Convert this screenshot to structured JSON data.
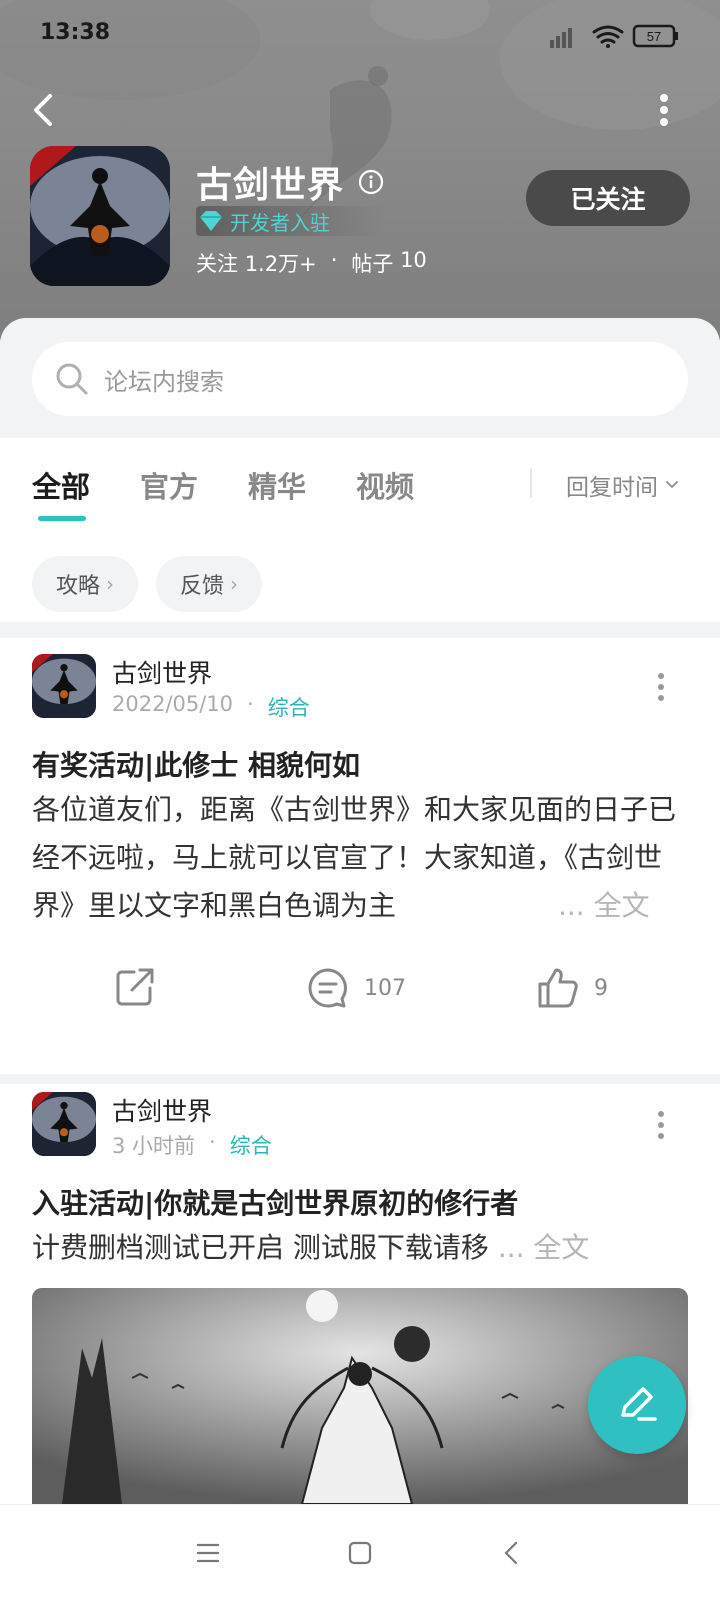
{
  "status_bar": {
    "time": "13:38",
    "battery": "57",
    "icons": [
      "signal-icon",
      "wifi-icon",
      "battery-icon"
    ]
  },
  "header": {
    "back_icon": "back-arrow-icon",
    "more_icon": "more-vertical-icon",
    "app_name": "古剑世界",
    "info_icon": "info-icon",
    "dev_badge": "开发者入驻",
    "follow_label": "关注",
    "follow_count": "1.2万+",
    "stats_sep": "·",
    "posts_label": "帖子",
    "posts_count": "10",
    "follow_button": "已关注"
  },
  "search": {
    "placeholder": "论坛内搜索"
  },
  "tabs": {
    "items": [
      {
        "label": "全部",
        "active": true
      },
      {
        "label": "官方",
        "active": false
      },
      {
        "label": "精华",
        "active": false
      },
      {
        "label": "视频",
        "active": false
      }
    ],
    "sort_label": "回复时间"
  },
  "chips": [
    {
      "label": "攻略"
    },
    {
      "label": "反馈"
    }
  ],
  "posts": [
    {
      "author": "古剑世界",
      "date": "2022/05/10",
      "sep": "·",
      "category": "综合",
      "title": "有奖活动|此修士 相貌何如",
      "body": "各位道友们，距离《古剑世界》和大家见面的日子已经不远啦，马上就可以官宣了！大家知道，《古剑世界》里以文字和黑白色调为主",
      "ellipsis": "...",
      "full_text": "全文",
      "comments": "107",
      "likes": "9"
    },
    {
      "author": "古剑世界",
      "date": "3 小时前",
      "sep": "·",
      "category": "综合",
      "title": "入驻活动|你就是古剑世界原初的修行者",
      "body": "计费删档测试已开启 测试服下载请移",
      "ellipsis": "...",
      "full_text": "全文"
    }
  ],
  "colors": {
    "accent": "#2ac3c3",
    "follow_button": "#4a4a4a",
    "header_bg": "#8a8a8a"
  }
}
